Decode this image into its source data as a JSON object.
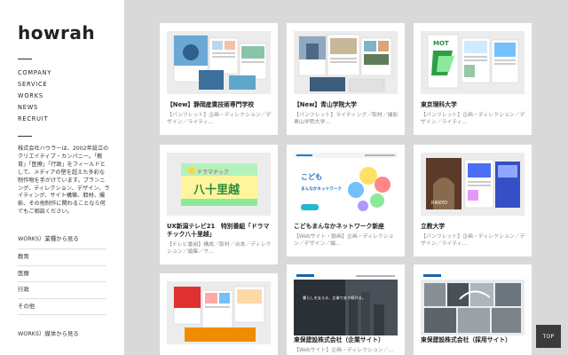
{
  "brand": {
    "logo": "howrah"
  },
  "nav": [
    "COMPANY",
    "SERVICE",
    "WORKS",
    "NEWS",
    "RECRUIT"
  ],
  "description": "株式会社ハウラーは、2002年設立のクリエイティブ・カンパニー。「教育」「医療」「行政」をフィールドとして、メディアの壁を超えた多彩な制作物を手がけています。プランニング、ディレクション、デザイン、ライティング、サイト構築、取材、撮影、その他制作に関わることなら何でもご相談ください。",
  "filters": {
    "by_industry_title": "WORKS）業種から見る",
    "industries": [
      "教育",
      "医療",
      "行政",
      "その他"
    ],
    "by_media_title": "WORKS）媒体から見る"
  },
  "cards": [
    {
      "title": "【New】静岡産業技術専門学校",
      "sub": "【パンフレット】企画・ディレクション／デザイン／ライティ…"
    },
    {
      "title": "【New】青山学院大学",
      "sub": "【パンフレット】ライティング／取材／撮影 青山学院大学…"
    },
    {
      "title": "東京理科大学",
      "sub": "【パンフレット】企画・ディレクション／デザイン／ライティ…"
    },
    {
      "title": "UX新潟テレビ21　特別番組「ドラマチック八十里越」",
      "sub": "【テレビ番組】構成／取材／台本／ディレクション／編集／サ…"
    },
    {
      "title": "こどもまんなかネットワーク新座",
      "sub": "【Webサイト・動画】企画・ディレクション／デザイン／編…"
    },
    {
      "title": "立教大学",
      "sub": "【パンフレット】企画・ディレクション／デザイン／ライティ…"
    },
    {
      "title": "",
      "sub": ""
    },
    {
      "title": "東保建設株式会社（企業サイト）",
      "sub": "【Webサイト】企画・ディレクション／…"
    },
    {
      "title": "東保建設株式会社（採用サイト）",
      "sub": ""
    }
  ],
  "thumb_text": {
    "hachijuri": "八十里越",
    "dorama": "ドラマチック",
    "kodomo": "こども",
    "network": "まんなかネットワーク",
    "kurashi": "暮らしを支える、企業であり続ける。",
    "rikkyo": "RIKKYO",
    "mot": "MOT"
  },
  "top_button": "TOP"
}
